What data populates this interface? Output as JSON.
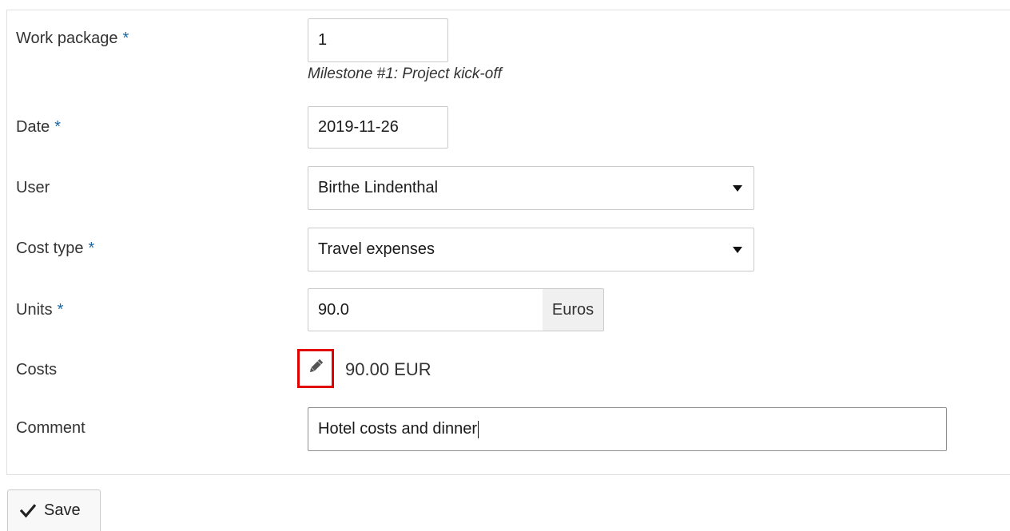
{
  "form": {
    "work_package": {
      "label": "Work package",
      "required": "*",
      "value": "1",
      "hint": "Milestone #1: Project kick-off"
    },
    "date": {
      "label": "Date",
      "required": "*",
      "value": "2019-11-26"
    },
    "user": {
      "label": "User",
      "value": "Birthe Lindenthal"
    },
    "cost_type": {
      "label": "Cost type",
      "required": "*",
      "value": "Travel expenses"
    },
    "units": {
      "label": "Units",
      "required": "*",
      "value": "90.0",
      "unit": "Euros"
    },
    "costs": {
      "label": "Costs",
      "value": "90.00 EUR"
    },
    "comment": {
      "label": "Comment",
      "value": "Hotel costs and dinner"
    }
  },
  "actions": {
    "save_label": "Save"
  },
  "icons": {
    "edit": "pencil-icon",
    "save": "checkmark-icon",
    "dropdown": "triangle-down-icon"
  },
  "colors": {
    "required_asterisk": "#1a67a3",
    "highlight_box": "#e00000"
  }
}
